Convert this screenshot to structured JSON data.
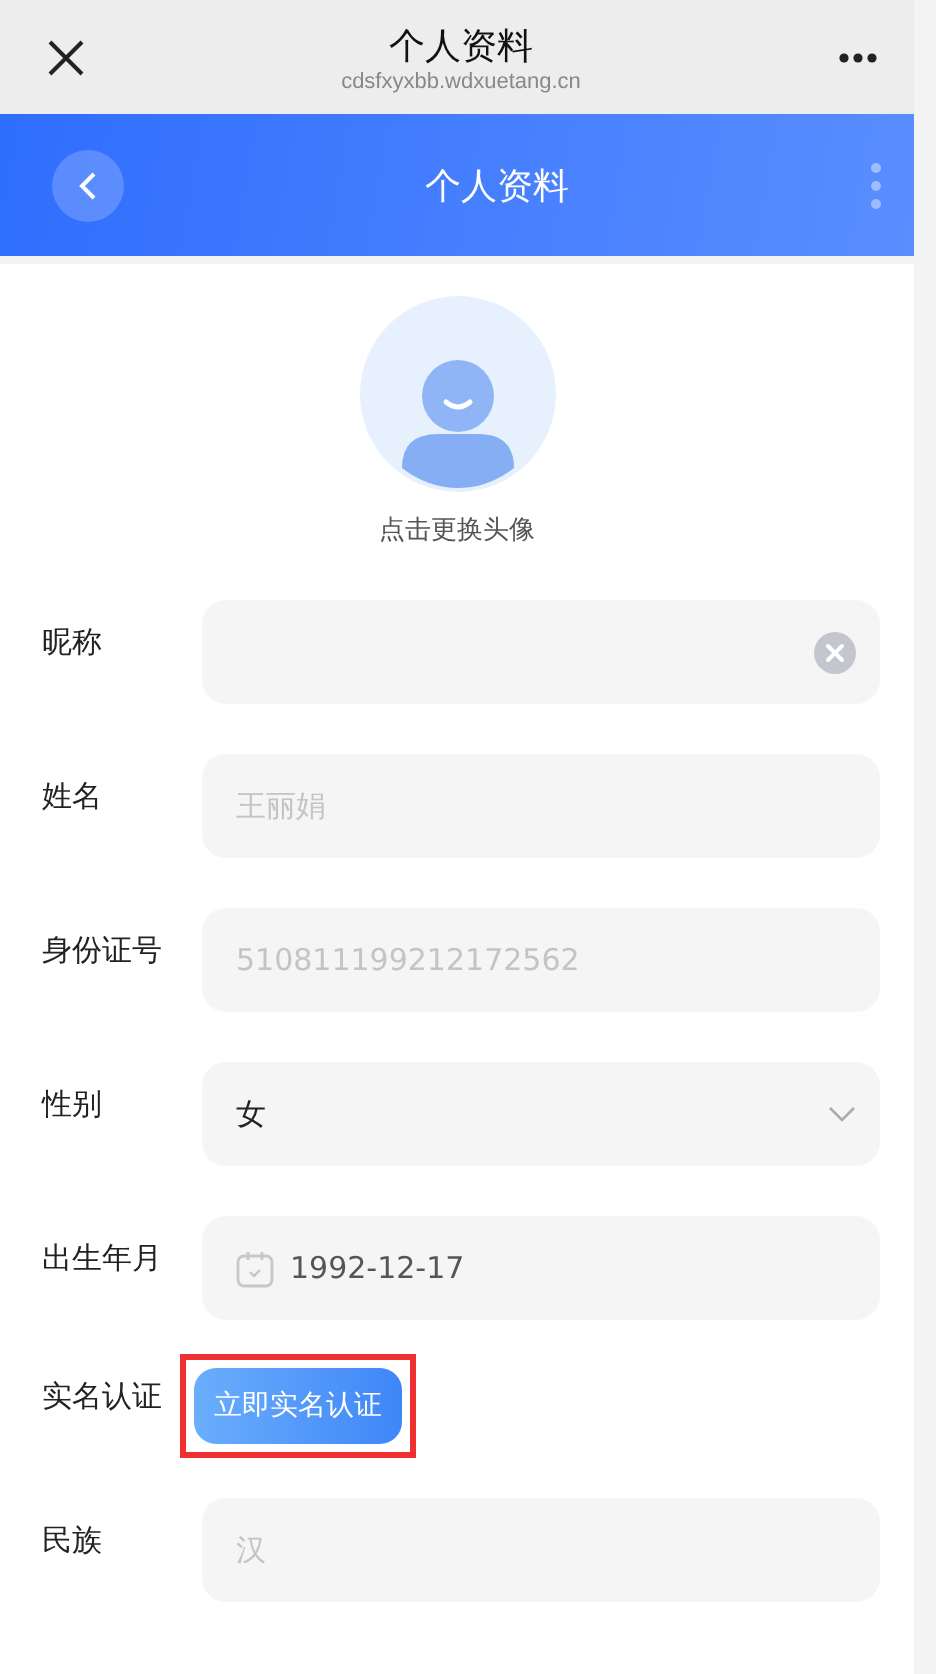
{
  "browser_bar": {
    "title": "个人资料",
    "url": "cdsfxyxbb.wdxuetang.cn"
  },
  "header": {
    "title": "个人资料"
  },
  "avatar": {
    "caption": "点击更换头像"
  },
  "fields": [
    {
      "label": "昵称",
      "kind": "text",
      "clearable": true
    },
    {
      "label": "姓名",
      "kind": "text",
      "value": "王丽娟",
      "clearable": false,
      "disabled": true
    },
    {
      "label": "身份证号",
      "kind": "text",
      "value": "510811199212172562",
      "clearable": false,
      "disabled": true
    },
    {
      "label": "性别",
      "kind": "select",
      "value": "女"
    },
    {
      "label": "出生年月",
      "kind": "date",
      "value": "1992-12-17"
    },
    {
      "label": "实名认证",
      "kind": "button",
      "button": "立即实名认证",
      "highlighted": true
    },
    {
      "label": "民族",
      "kind": "text",
      "value": "汉",
      "clearable": false,
      "disabled": true
    }
  ]
}
